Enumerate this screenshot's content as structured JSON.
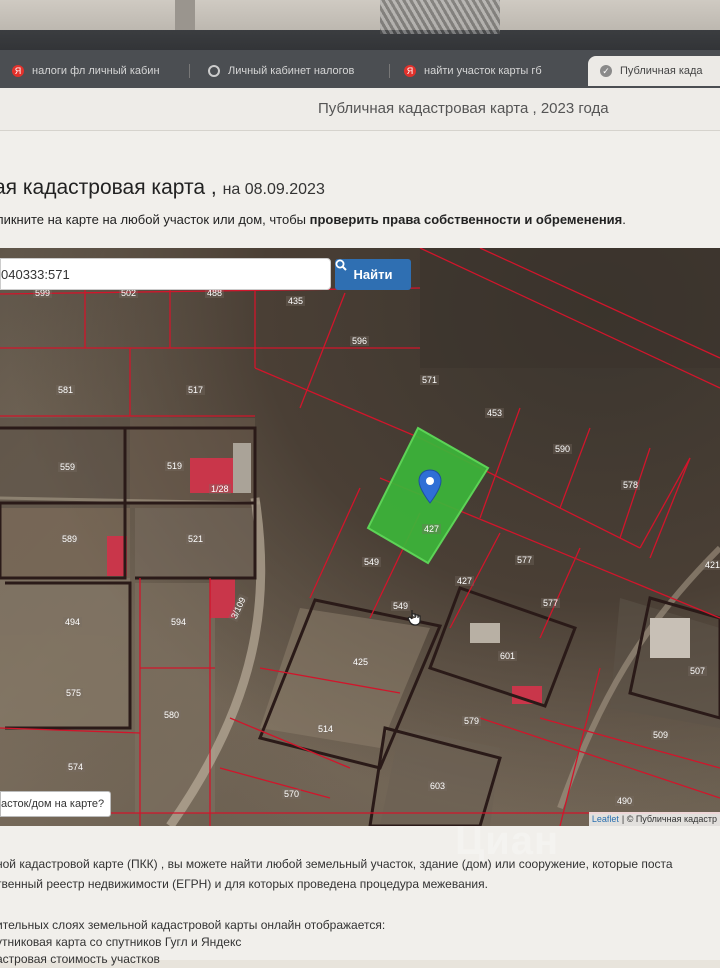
{
  "browser": {
    "tabs": [
      {
        "label": "налоги фл личный кабин",
        "icon": "yandex-icon"
      },
      {
        "label": "Личный кабинет налогов",
        "icon": "globe-icon"
      },
      {
        "label": "найти участок карты гб",
        "icon": "yandex-icon"
      },
      {
        "label": "Публичная када",
        "icon": "check-icon"
      }
    ],
    "page_title": "Публичная кадастровая карта , 2023 года"
  },
  "header": {
    "title": "ая кадастровая карта",
    "comma": ",",
    "date": "на 08.09.2023",
    "lead_plain": "ликните на карте на любой участок или дом, чтобы ",
    "lead_bold": "проверить права собственности и обременения",
    "lead_end": "."
  },
  "map": {
    "search_value": "040333:571",
    "find_label": "Найти",
    "hint_label": "асток/дом на карте?",
    "attribution_leaflet": "Leaflet",
    "attribution_rest": "| © Публичная кадастр",
    "watermark": "Циан",
    "selected_parcel": "571",
    "parcel_labels": [
      "599",
      "502",
      "488",
      "435",
      "596",
      "571",
      "581",
      "517",
      "453",
      "590",
      "559",
      "519",
      "1/28",
      "578",
      "589",
      "521",
      "427",
      "549",
      "577",
      "427",
      "549",
      "577",
      "421",
      "494",
      "594",
      "3/109",
      "425",
      "601",
      "507",
      "575",
      "580",
      "514",
      "579",
      "509",
      "574",
      "570",
      "603",
      "490"
    ]
  },
  "body": {
    "line1": "ной кадастровой карте (ПКК) , вы можете найти любой земельный участок, здание (дом) или сооружение, которые поста",
    "line2": "твенный реестр недвижимости (ЕГРН) и для которых проведена процедура межевания.",
    "line3": "ительных слоях земельной кадастровой карты онлайн отображается:",
    "line4": "утниковая карта со спутников Гугл и Яндекс",
    "line5": "астровая стоимость участков"
  }
}
